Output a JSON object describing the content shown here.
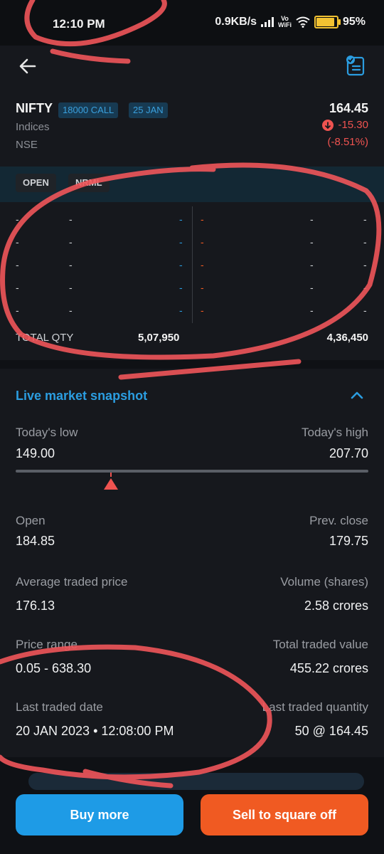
{
  "status_bar": {
    "time": "12:10 PM",
    "network_speed": "0.9KB/s",
    "vowifi_line1": "Vo",
    "vowifi_line2": "WiFi",
    "battery": "95%",
    "battery_level": 0.95
  },
  "header": {
    "back_icon": "back-arrow-icon",
    "action_icon": "order-document-icon"
  },
  "instrument": {
    "symbol": "NIFTY",
    "strike_tag": "18000 CALL",
    "expiry_tag": "25 JAN",
    "segment": "Indices",
    "exchange": "NSE",
    "ltp": "164.45",
    "change": "-15.30",
    "change_pct": "(-8.51%)",
    "down_color": "#ef5350"
  },
  "product_tags": [
    "OPEN",
    "NRML"
  ],
  "market_depth": {
    "rows": [
      {
        "bid_price": "-",
        "orders": "-",
        "bid_qty": "-",
        "ask_qty": "-",
        "ask_orders": "-",
        "ask_price": "-"
      },
      {
        "bid_price": "-",
        "orders": "-",
        "bid_qty": "-",
        "ask_qty": "-",
        "ask_orders": "-",
        "ask_price": "-"
      },
      {
        "bid_price": "-",
        "orders": "-",
        "bid_qty": "-",
        "ask_qty": "-",
        "ask_orders": "-",
        "ask_price": "-"
      },
      {
        "bid_price": "-",
        "orders": "-",
        "bid_qty": "-",
        "ask_qty": "-",
        "ask_orders": "-",
        "ask_price": "-"
      },
      {
        "bid_price": "-",
        "orders": "-",
        "bid_qty": "-",
        "ask_qty": "-",
        "ask_orders": "-",
        "ask_price": "-"
      }
    ],
    "total_qty_label": "TOTAL QTY",
    "total_bid_qty": "5,07,950",
    "total_ask_qty": "4,36,450",
    "bid_color": "#2b9de0",
    "ask_color": "#f05a22"
  },
  "snapshot": {
    "title": "Live market snapshot",
    "todays_low_label": "Today's low",
    "todays_low": "149.00",
    "todays_high_label": "Today's high",
    "todays_high": "207.70",
    "ltp_position_fraction": 0.27,
    "open_label": "Open",
    "open": "184.85",
    "prev_close_label": "Prev. close",
    "prev_close": "179.75",
    "avg_price_label": "Average traded price",
    "avg_price": "176.13",
    "volume_label": "Volume (shares)",
    "volume": "2.58 crores",
    "price_range_label": "Price range",
    "price_range": "0.05 - 638.30",
    "total_value_label": "Total traded value",
    "total_value": "455.22 crores",
    "last_date_label": "Last traded date",
    "last_date": "20 JAN 2023 • 12:08:00 PM",
    "last_qty_label": "Last traded quantity",
    "last_qty": "50 @ 164.45"
  },
  "actions": {
    "buy_label": "Buy more",
    "sell_label": "Sell to square off",
    "buy_color": "#1e9be6",
    "sell_color": "#f05a22"
  }
}
